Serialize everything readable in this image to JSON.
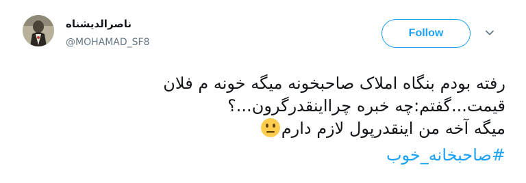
{
  "user": {
    "display_name": "ناصرالدیشناه",
    "handle": "@MOHAMAD_SF8"
  },
  "follow_button": {
    "label": "Follow"
  },
  "menu": {
    "icon": "chevron-down-icon"
  },
  "tweet": {
    "line1": "رفته بودم بنگاه املاک صاحبخونه میگه خونه م فلان",
    "line2": "قیمت...گفتم:چه خبره چرااینقدرگرون...؟",
    "line3": "میگه آخه من اینقدرپول لازم دارم",
    "emoji": "neutral-face-emoji",
    "hashtag": "#صاحبخانه_خوب"
  },
  "colors": {
    "accent": "#1da1f2",
    "text": "#14171a",
    "secondary": "#657786"
  }
}
